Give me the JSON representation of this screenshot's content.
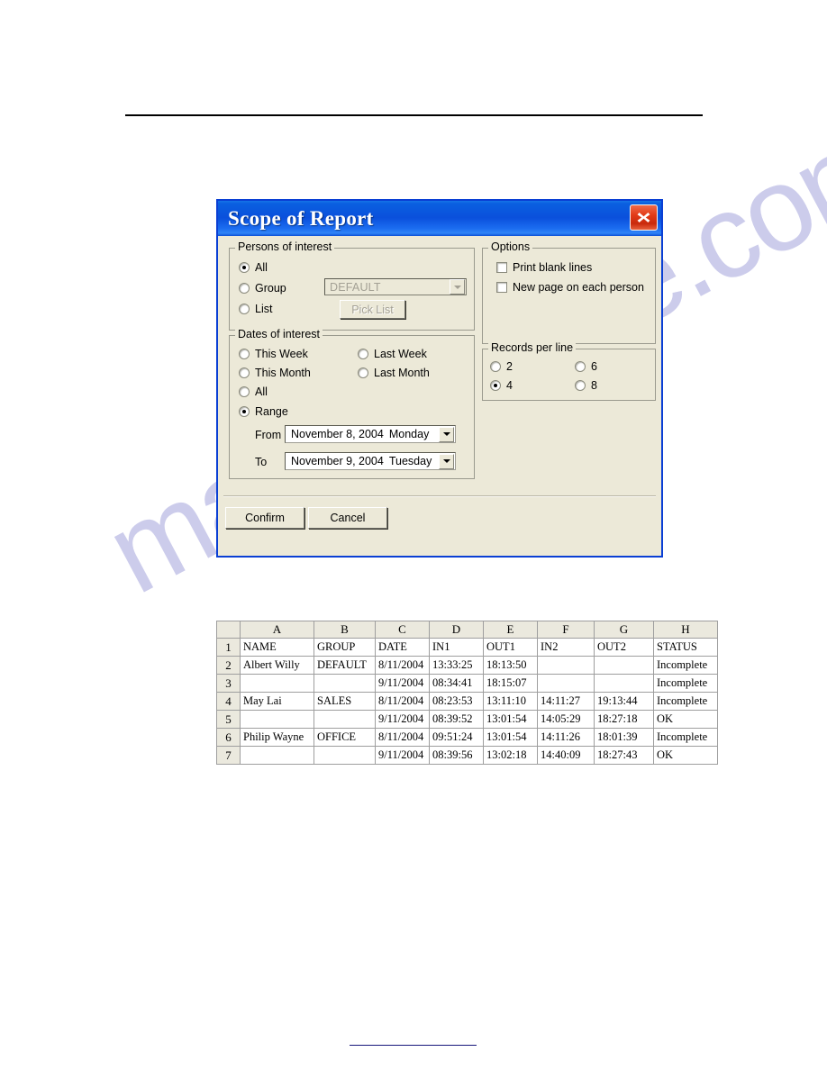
{
  "page": {
    "header_rule": true,
    "footer_rule": true,
    "watermark_text": "manualshive.com"
  },
  "dialog": {
    "title": "Scope of Report",
    "close_icon": "close-icon",
    "persons": {
      "legend": "Persons of interest",
      "options": [
        {
          "label": "All",
          "selected": true
        },
        {
          "label": "Group",
          "selected": false
        },
        {
          "label": "List",
          "selected": false
        }
      ],
      "group_combo": {
        "value": "DEFAULT",
        "enabled": false,
        "arrow_icon": "chevron-down-icon"
      },
      "pick_list_button": {
        "label": "Pick List",
        "enabled": false
      }
    },
    "dates": {
      "legend": "Dates of interest",
      "options": [
        {
          "label": "This Week",
          "selected": false
        },
        {
          "label": "Last Week",
          "selected": false
        },
        {
          "label": "This Month",
          "selected": false
        },
        {
          "label": "Last Month",
          "selected": false
        },
        {
          "label": "All",
          "selected": false
        },
        {
          "label": "Range",
          "selected": true
        }
      ],
      "from": {
        "label": "From",
        "month_day_year": "November   8, 2004",
        "weekday": "Monday",
        "arrow_icon": "chevron-down-icon"
      },
      "to": {
        "label": "To",
        "month_day_year": "November   9, 2004",
        "weekday": "Tuesday",
        "arrow_icon": "chevron-down-icon"
      }
    },
    "options": {
      "legend": "Options",
      "items": [
        {
          "label": "Print blank lines",
          "checked": false
        },
        {
          "label": "New page on each person",
          "checked": false
        }
      ]
    },
    "records_per_line": {
      "legend": "Records per line",
      "items": [
        {
          "label": "2",
          "selected": false
        },
        {
          "label": "6",
          "selected": false
        },
        {
          "label": "4",
          "selected": true
        },
        {
          "label": "8",
          "selected": false
        }
      ]
    },
    "buttons": {
      "confirm": "Confirm",
      "cancel": "Cancel"
    }
  },
  "spreadsheet": {
    "column_letters": [
      "A",
      "B",
      "C",
      "D",
      "E",
      "F",
      "G",
      "H"
    ],
    "row_numbers": [
      "1",
      "2",
      "3",
      "4",
      "5",
      "6",
      "7"
    ],
    "rows": [
      [
        "NAME",
        "GROUP",
        "DATE",
        "IN1",
        "OUT1",
        "IN2",
        "OUT2",
        "STATUS"
      ],
      [
        "Albert Willy",
        "DEFAULT",
        "8/11/2004",
        "13:33:25",
        "18:13:50",
        "",
        "",
        "Incomplete"
      ],
      [
        "",
        "",
        "9/11/2004",
        "08:34:41",
        "18:15:07",
        "",
        "",
        "Incomplete"
      ],
      [
        "May Lai",
        "SALES",
        "8/11/2004",
        "08:23:53",
        "13:11:10",
        "14:11:27",
        "19:13:44",
        "Incomplete"
      ],
      [
        "",
        "",
        "9/11/2004",
        "08:39:52",
        "13:01:54",
        "14:05:29",
        "18:27:18",
        "OK"
      ],
      [
        "Philip Wayne",
        "OFFICE",
        "8/11/2004",
        "09:51:24",
        "13:01:54",
        "14:11:26",
        "18:01:39",
        "Incomplete"
      ],
      [
        "",
        "",
        "9/11/2004",
        "08:39:56",
        "13:02:18",
        "14:40:09",
        "18:27:43",
        "OK"
      ]
    ]
  },
  "colors": {
    "title_bar_blue": "#0a50dc",
    "dialog_face": "#ece9d8",
    "close_red": "#e23b18",
    "watermark": "#b9b9e4",
    "footer_rule": "#17177a"
  }
}
